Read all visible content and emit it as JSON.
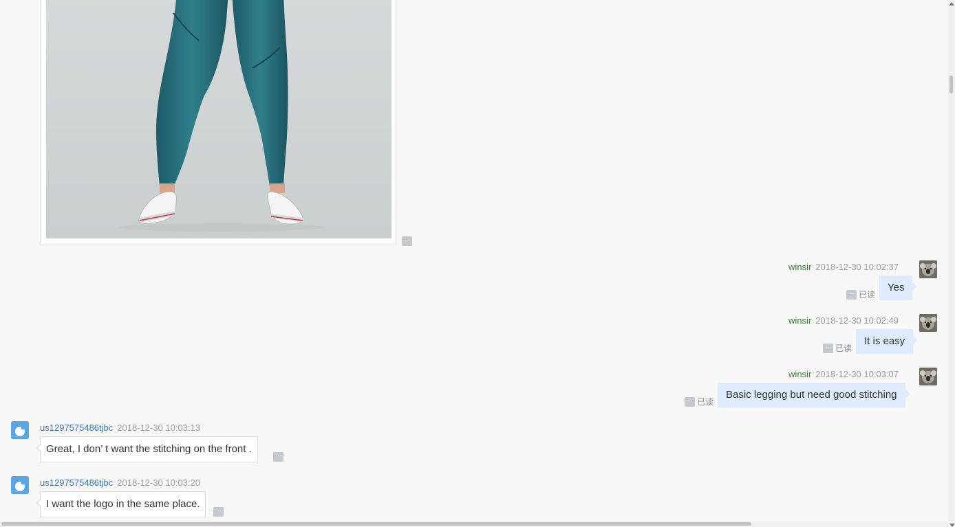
{
  "chat": {
    "image_message": {
      "image_alt": "Person wearing teal leggings and white sneakers",
      "more_label": "···"
    },
    "messages": [
      {
        "sender": "winsir",
        "time": "2018-12-30 10:02:37",
        "text": "Yes",
        "status": "已读",
        "more_label": "···"
      },
      {
        "sender": "winsir",
        "time": "2018-12-30 10:02:49",
        "text": "It is easy",
        "status": "已读",
        "more_label": "···"
      },
      {
        "sender": "winsir",
        "time": "2018-12-30 10:03:07",
        "text": "Basic legging but need good stitching",
        "status": "已读",
        "more_label": "···"
      },
      {
        "sender": "us1297575486tjbc",
        "time": "2018-12-30 10:03:13",
        "text": "Great, I don’ t want the stitching on the front .",
        "more_label": "···"
      },
      {
        "sender": "us1297575486tjbc",
        "time": "2018-12-30 10:03:20",
        "text": "I want the logo in the same place.",
        "more_label": "···"
      }
    ]
  },
  "colors": {
    "self_name": "#3a7a32",
    "other_name": "#3d73b7",
    "self_bubble": "#deecfd",
    "background": "#f8f8f8"
  }
}
